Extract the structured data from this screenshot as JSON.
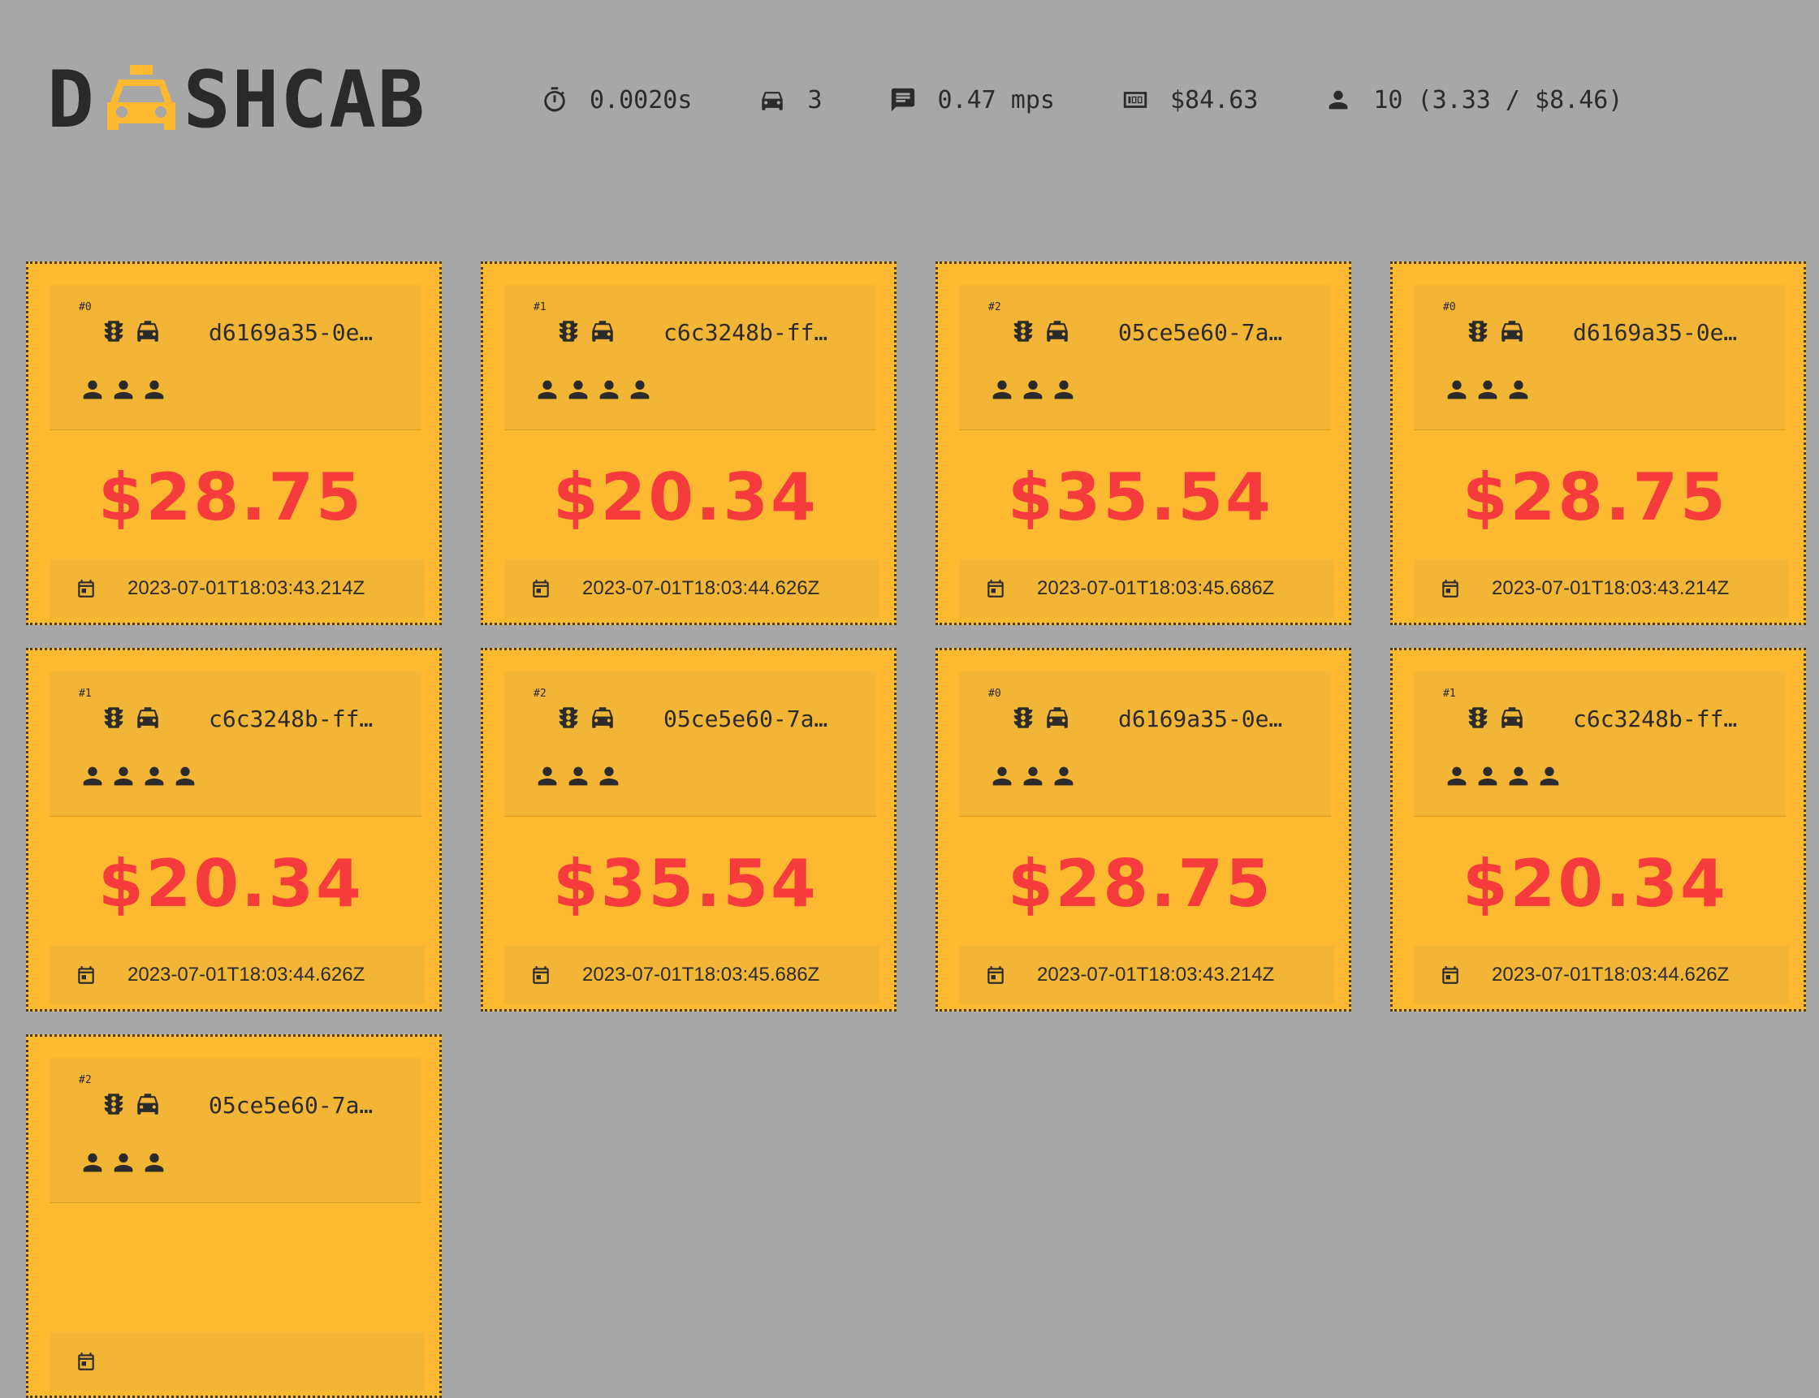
{
  "logo": {
    "text_left": "D",
    "text_right": "SHCAB",
    "icon": "taxi-icon"
  },
  "stats": [
    {
      "icon": "timer-icon",
      "value": "0.0020s"
    },
    {
      "icon": "car-icon",
      "value": "3"
    },
    {
      "icon": "message-icon",
      "value": "0.47 mps"
    },
    {
      "icon": "money-icon",
      "value": "$84.63"
    },
    {
      "icon": "person-icon",
      "value": "10 (3.33 / $8.46)"
    }
  ],
  "cards": [
    {
      "index": "#0",
      "id": "d6169a35-0e…",
      "passengers": 3,
      "price": "$28.75",
      "timestamp": "2023-07-01T18:03:43.214Z"
    },
    {
      "index": "#1",
      "id": "c6c3248b-ff…",
      "passengers": 4,
      "price": "$20.34",
      "timestamp": "2023-07-01T18:03:44.626Z"
    },
    {
      "index": "#2",
      "id": "05ce5e60-7a…",
      "passengers": 3,
      "price": "$35.54",
      "timestamp": "2023-07-01T18:03:45.686Z"
    },
    {
      "index": "#0",
      "id": "d6169a35-0e…",
      "passengers": 3,
      "price": "$28.75",
      "timestamp": "2023-07-01T18:03:43.214Z"
    },
    {
      "index": "#1",
      "id": "c6c3248b-ff…",
      "passengers": 4,
      "price": "$20.34",
      "timestamp": "2023-07-01T18:03:44.626Z"
    },
    {
      "index": "#2",
      "id": "05ce5e60-7a…",
      "passengers": 3,
      "price": "$35.54",
      "timestamp": "2023-07-01T18:03:45.686Z"
    },
    {
      "index": "#0",
      "id": "d6169a35-0e…",
      "passengers": 3,
      "price": "$28.75",
      "timestamp": "2023-07-01T18:03:43.214Z"
    },
    {
      "index": "#1",
      "id": "c6c3248b-ff…",
      "passengers": 4,
      "price": "$20.34",
      "timestamp": "2023-07-01T18:03:44.626Z"
    },
    {
      "index": "#2",
      "id": "05ce5e60-7a…",
      "passengers": 3,
      "price": "",
      "timestamp": ""
    }
  ],
  "colors": {
    "background": "#a7a7a7",
    "card": "#fdba31",
    "price": "#f53b3b",
    "text": "#2b2b2b"
  }
}
